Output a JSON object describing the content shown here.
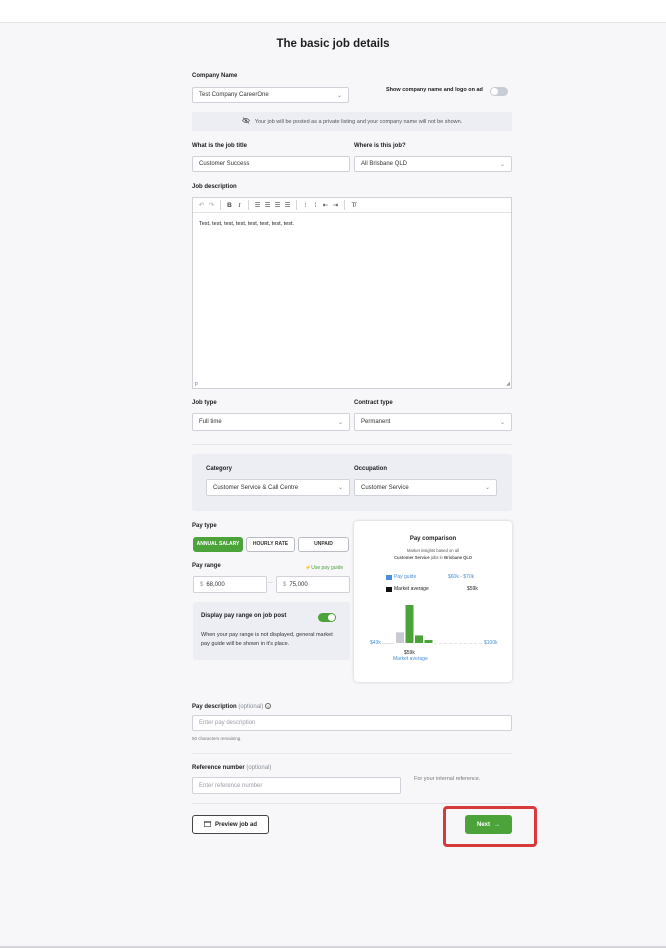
{
  "page": {
    "title": "The basic job details"
  },
  "company": {
    "label": "Company Name",
    "value": "Test Company CareerOne",
    "toggle_label": "Show company name and logo on ad",
    "toggle_on": false,
    "private_notice": "Your job will be posted as a private listing and your company name will not be shown."
  },
  "job_title": {
    "label": "What is the job title",
    "value": "Customer Success"
  },
  "location": {
    "label": "Where is this job?",
    "value": "All Brisbane QLD"
  },
  "description": {
    "label": "Job description",
    "content": "Test, test, test, test, test, test, test, test.",
    "footer": "p"
  },
  "job_type": {
    "label": "Job type",
    "value": "Full time"
  },
  "contract_type": {
    "label": "Contract type",
    "value": "Permanent"
  },
  "category": {
    "label": "Category",
    "value": "Customer Service & Call Centre"
  },
  "occupation": {
    "label": "Occupation",
    "value": "Customer Service"
  },
  "pay_type": {
    "label": "Pay type",
    "options": [
      "ANNUAL SALARY",
      "HOURLY RATE",
      "UNPAID"
    ],
    "selected": "ANNUAL SALARY"
  },
  "pay_range": {
    "label": "Pay range",
    "use_guide": "Use pay guide",
    "currency": "$",
    "min": "68,000",
    "max": "75,000",
    "separator": "—"
  },
  "display_range": {
    "label": "Display pay range on job post",
    "toggle_on": true,
    "note": "When your pay range is not displayed, general market pay guide will be shown in it's place."
  },
  "pay_comparison": {
    "title": "Pay comparison",
    "subtitle_prefix": "Market insights based on all",
    "subtitle_bold1": "Customer Service",
    "subtitle_mid": "jobs in",
    "subtitle_bold2": "Brisbane QLD",
    "legend": [
      {
        "name": "Pay guide",
        "value": "$60k - $70k",
        "color": "#4a90d9"
      },
      {
        "name": "Market average",
        "value": "$59k",
        "color": "#111111"
      }
    ],
    "axis_min": "$43k",
    "axis_max": "$100k",
    "marker_value": "$59k",
    "marker_label": "Market average"
  },
  "chart_data": {
    "type": "bar",
    "bars": [
      {
        "height": 0.28,
        "color": "#c7cad1"
      },
      {
        "height": 1.0,
        "color": "#4ba33a"
      },
      {
        "height": 0.2,
        "color": "#4ba33a"
      },
      {
        "height": 0.08,
        "color": "#4ba33a"
      }
    ]
  },
  "pay_description": {
    "label": "Pay description",
    "optional": "(optional)",
    "placeholder": "Enter pay description",
    "remaining": "50 characters remaining."
  },
  "reference": {
    "label": "Reference number",
    "optional": "(optional)",
    "placeholder": "Enter reference number",
    "hint": "For your internal reference."
  },
  "actions": {
    "preview": "Preview job ad",
    "next": "Next"
  },
  "colors": {
    "accent": "#4ba33a",
    "highlight": "#d63a3a"
  }
}
